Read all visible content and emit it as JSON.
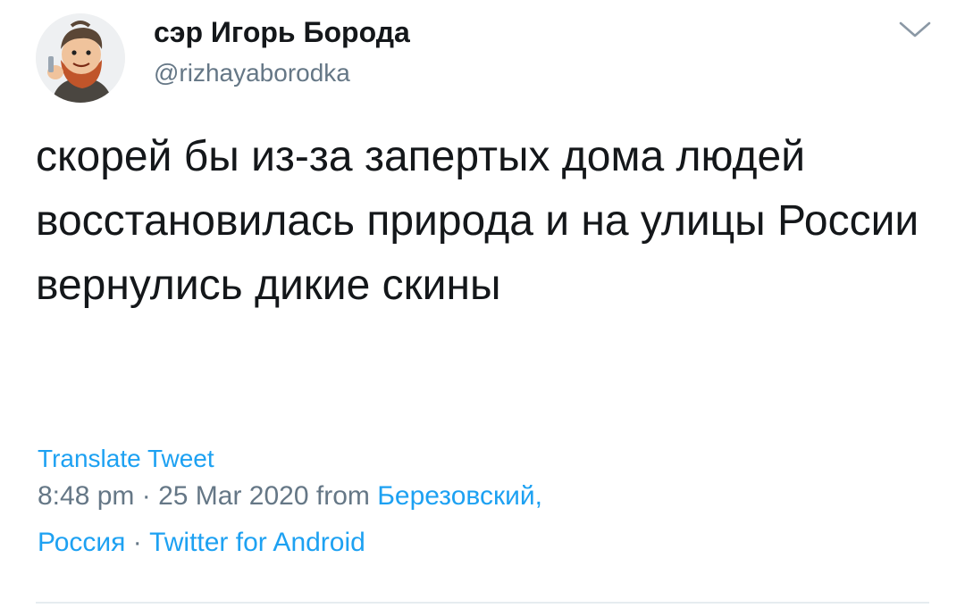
{
  "author": {
    "display_name": "сэр Игорь Борода",
    "handle": "@rizhayaborodka"
  },
  "menu": {
    "icon": "chevron-down-icon"
  },
  "tweet": {
    "text": "скорей бы из-за запертых дома людей восстановилась природа и на улицы России вернулись дикие скины",
    "translate_label": "Translate Tweet"
  },
  "meta": {
    "time": "8:48 pm",
    "sep1": " · ",
    "date": "25 Mar 2020",
    "from_word": " from ",
    "location_line1": "Березовский,",
    "location_line2": "Россия",
    "sep2": " · ",
    "client": "Twitter for Android"
  },
  "colors": {
    "link": "#1da1f2",
    "secondary": "#657786",
    "text": "#14171a",
    "divider": "#e6ecf0"
  }
}
